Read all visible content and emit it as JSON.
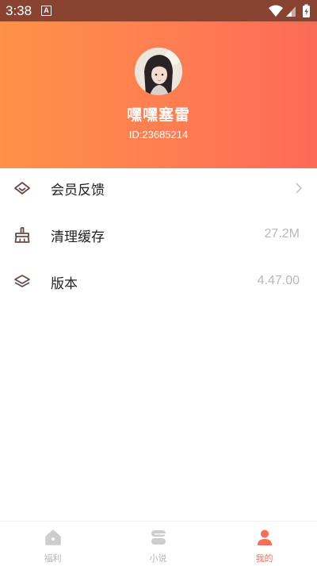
{
  "status_bar": {
    "time": "3:38",
    "notification_icon": "A"
  },
  "profile": {
    "username": "嘿嘿塞雷",
    "user_id": "ID:23685214"
  },
  "menu": {
    "items": [
      {
        "icon": "diamond-icon",
        "label": "会员反馈",
        "value": "",
        "has_chevron": true
      },
      {
        "icon": "broom-icon",
        "label": "清理缓存",
        "value": "27.2M",
        "has_chevron": false
      },
      {
        "icon": "layers-icon",
        "label": "版本",
        "value": "4.47.00",
        "has_chevron": false
      }
    ]
  },
  "tabbar": {
    "tabs": [
      {
        "icon": "home-icon",
        "label": "福利",
        "active": false
      },
      {
        "icon": "book-icon",
        "label": "小说",
        "active": false
      },
      {
        "icon": "person-icon",
        "label": "我的",
        "active": true
      }
    ]
  },
  "colors": {
    "header_gradient_start": "#ff9148",
    "header_gradient_end": "#fd6a58",
    "status_bar": "#894331",
    "accent": "#fb6d55",
    "icon_stroke": "#6b4a45",
    "value_text": "#b8b8b8",
    "inactive_tab": "#b5b5b5"
  }
}
